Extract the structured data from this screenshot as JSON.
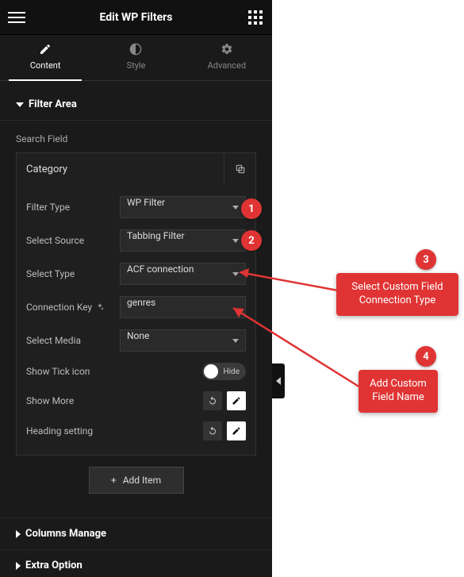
{
  "header": {
    "title": "Edit WP Filters"
  },
  "tabs": [
    {
      "label": "Content",
      "active": true
    },
    {
      "label": "Style",
      "active": false
    },
    {
      "label": "Advanced",
      "active": false
    }
  ],
  "sections": {
    "filter_area": {
      "title": "Filter Area",
      "expanded": true
    },
    "columns_manage": {
      "title": "Columns Manage",
      "expanded": false
    },
    "extra_option": {
      "title": "Extra Option",
      "expanded": false
    }
  },
  "search_field_label": "Search Field",
  "card": {
    "head": "Category",
    "rows": {
      "filter_type": {
        "label": "Filter Type",
        "value": "WP Filter"
      },
      "select_source": {
        "label": "Select Source",
        "value": "Tabbing Filter"
      },
      "select_type": {
        "label": "Select Type",
        "value": "ACF connection"
      },
      "connection_key": {
        "label": "Connection Key",
        "value": "genres"
      },
      "select_media": {
        "label": "Select Media",
        "value": "None"
      },
      "show_tick": {
        "label": "Show Tick icon",
        "toggle_text": "Hide"
      },
      "show_more": {
        "label": "Show More"
      },
      "heading_setting": {
        "label": "Heading setting"
      }
    },
    "add_item": "Add Item"
  },
  "annotations": {
    "b1": "1",
    "b2": "2",
    "b3": "3",
    "b4": "4",
    "c3": "Select Custom Field\nConnection Type",
    "c4": "Add Custom\nField Name"
  }
}
